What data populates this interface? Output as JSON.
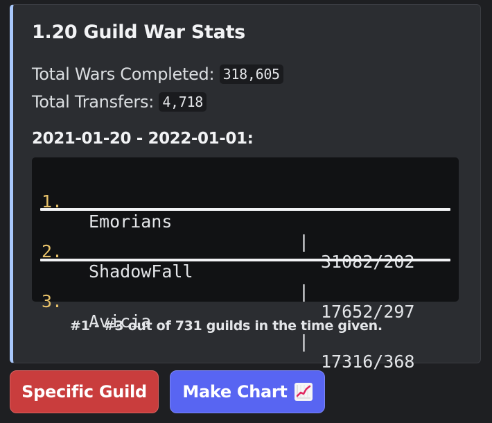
{
  "embed": {
    "title": "1.20 Guild War Stats",
    "stats": {
      "wars_label": "Total Wars Completed: ",
      "wars_value": "318,605",
      "transfers_label": "Total Transfers: ",
      "transfers_value": "4,718"
    },
    "range": "2021-01-20 - 2022-01-01:",
    "leaderboard": [
      {
        "rank": "1.",
        "name": "Emorians",
        "sep": "|",
        "score": "31082/202"
      },
      {
        "rank": "2.",
        "name": "ShadowFall",
        "sep": "|",
        "score": "17652/297"
      },
      {
        "rank": "3.",
        "name": "Avicia",
        "sep": "|",
        "score": "17316/368"
      }
    ],
    "footer": "#1 - #3 out of 731 guilds in the time given."
  },
  "buttons": {
    "specific_guild": "Specific Guild",
    "make_chart": "Make Chart",
    "make_chart_icon": "chart-increasing-icon"
  },
  "colors": {
    "embed_accent": "#a8c7fa",
    "rank_color": "#e8c26a",
    "danger_button": "#c93d3d",
    "primary_button": "#5865f2"
  }
}
